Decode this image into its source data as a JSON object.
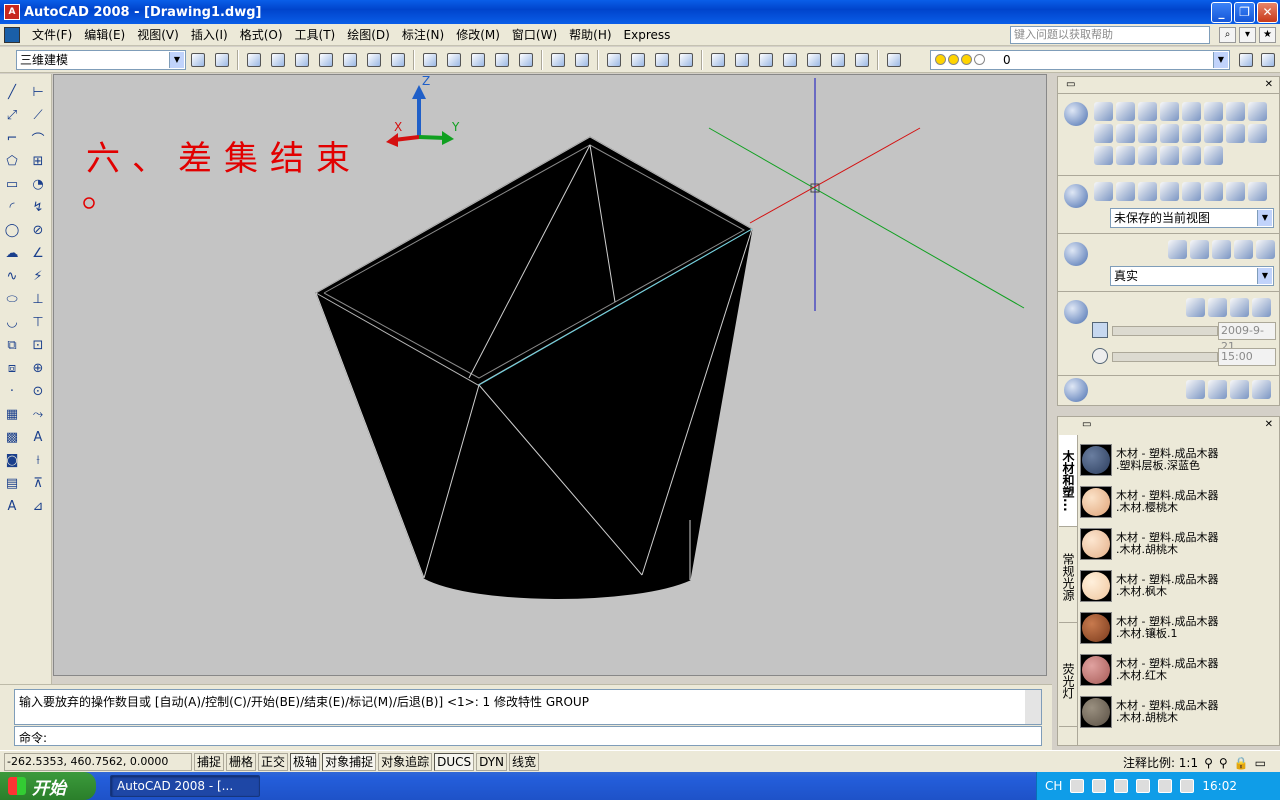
{
  "window": {
    "title": "AutoCAD 2008 - [Drawing1.dwg]",
    "buttons": [
      "_",
      "❐",
      "✕"
    ]
  },
  "menubar": {
    "items": [
      "文件(F)",
      "编辑(E)",
      "视图(V)",
      "插入(I)",
      "格式(O)",
      "工具(T)",
      "绘图(D)",
      "标注(N)",
      "修改(M)",
      "窗口(W)",
      "帮助(H)",
      "Express"
    ],
    "help_placeholder": "键入问题以获取帮助"
  },
  "toolbar": {
    "workspace": "三维建模",
    "layer": "0"
  },
  "viewport": {
    "title_text": "六、差集结束",
    "ucs": {
      "z": "Z",
      "x": "X",
      "y": "Y"
    }
  },
  "dashboard": {
    "view_combo": "未保存的当前视图",
    "style_combo": "真实",
    "date_value": "2009-9-21",
    "time_value": "15:00"
  },
  "palette": {
    "tabs": [
      "木材和塑...",
      "常规光源",
      "荧光灯"
    ],
    "materials": [
      {
        "line1": "木材 - 塑料.成品木器",
        "line2": ".塑料层板.深蓝色",
        "color": "#2c3e5e"
      },
      {
        "line1": "木材 - 塑料.成品木器",
        "line2": ".木材.樱桃木",
        "color": "#e0a478"
      },
      {
        "line1": "木材 - 塑料.成品木器",
        "line2": ".木材.胡桃木",
        "color": "#e4b08a"
      },
      {
        "line1": "木材 - 塑料.成品木器",
        "line2": ".木材.枫木",
        "color": "#f0c69e"
      },
      {
        "line1": "木材 - 塑料.成品木器",
        "line2": ".木材.镶板.1",
        "color": "#7a3a1c"
      },
      {
        "line1": "木材 - 塑料.成品木器",
        "line2": ".木材.红木",
        "color": "#a65a56"
      },
      {
        "line1": "木材 - 塑料.成品木器",
        "line2": ".木材.胡桃木",
        "color": "#5a5044"
      }
    ]
  },
  "command": {
    "history": "输入要放弃的操作数目或 [自动(A)/控制(C)/开始(BE)/结束(E)/标记(M)/后退(B)] <1>: 1 修改特性 GROUP",
    "prompt": "命令:"
  },
  "status": {
    "coords": "-262.5353, 460.7562, 0.0000",
    "buttons": [
      "捕捉",
      "栅格",
      "正交",
      "极轴",
      "对象捕捉",
      "对象追踪",
      "DUCS",
      "DYN",
      "线宽"
    ],
    "active": [
      "极轴",
      "对象捕捉",
      "DUCS"
    ],
    "annotation_scale": "注释比例: 1:1"
  },
  "taskbar": {
    "start": "开始",
    "task": "AutoCAD 2008 - [...",
    "lang": "CH",
    "clock": "16:02"
  }
}
